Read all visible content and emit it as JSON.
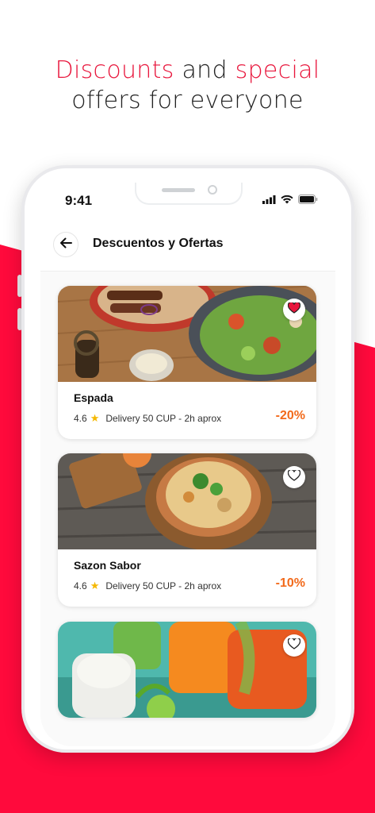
{
  "headline": {
    "word1": "Discounts",
    "word2": " and ",
    "word3": "special",
    "line2": "offers for everyone"
  },
  "status_bar": {
    "time": "9:41",
    "icons": [
      "signal-icon",
      "wifi-icon",
      "battery-icon"
    ]
  },
  "app_bar": {
    "back_icon": "arrow-left-icon",
    "title": "Descuentos y Ofertas"
  },
  "restaurants": [
    {
      "name": "Espada",
      "rating": "4.6",
      "delivery": "Delivery 50 CUP - 2h aprox",
      "discount": "-20%",
      "favorite": true
    },
    {
      "name": "Sazon Sabor",
      "rating": "4.6",
      "delivery": "Delivery 50 CUP - 2h aprox",
      "discount": "-10%",
      "favorite": false
    },
    {
      "name": "",
      "rating": "",
      "delivery": "",
      "discount": "",
      "favorite": false
    }
  ],
  "colors": {
    "accent": "#e8163c",
    "discount": "#f26a1b",
    "star": "#f5b800"
  }
}
